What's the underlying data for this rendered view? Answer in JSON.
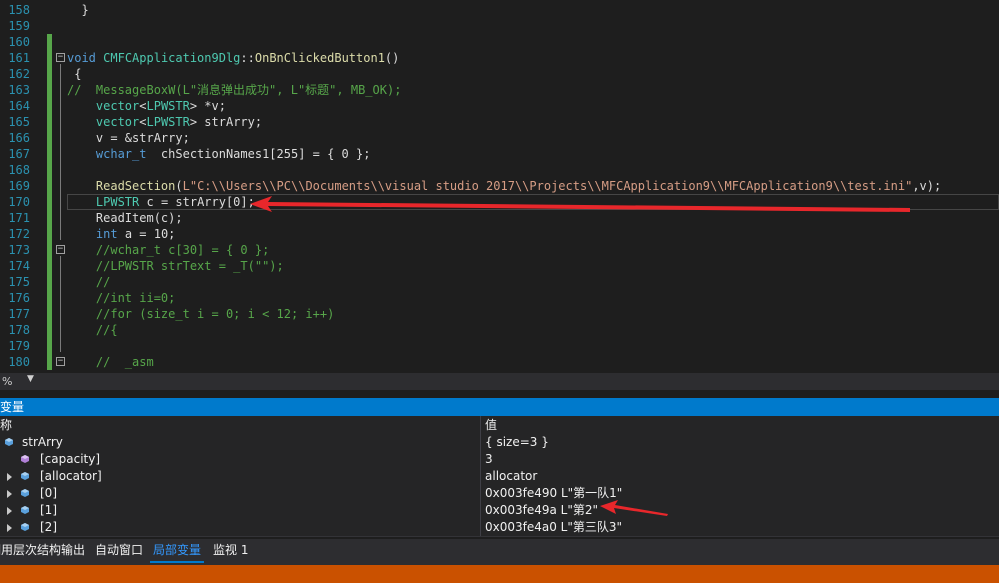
{
  "editor": {
    "lines": [
      {
        "n": "158",
        "text": "  }"
      },
      {
        "n": "159",
        "text": ""
      },
      {
        "n": "160",
        "text": ""
      },
      {
        "n": "161",
        "text": "void CMFCApplication9Dlg::OnBnClickedButton1()"
      },
      {
        "n": "162",
        "text": " {"
      },
      {
        "n": "163",
        "text": "//  MessageBoxW(L\"消息弹出成功\", L\"标题\", MB_OK);"
      },
      {
        "n": "164",
        "text": "    vector<LPWSTR> *v;"
      },
      {
        "n": "165",
        "text": "    vector<LPWSTR> strArry;"
      },
      {
        "n": "166",
        "text": "    v = &strArry;"
      },
      {
        "n": "167",
        "text": "    wchar_t  chSectionNames1[255] = { 0 };"
      },
      {
        "n": "168",
        "text": ""
      },
      {
        "n": "169",
        "text": "    ReadSection(L\"C:\\\\Users\\\\PC\\\\Documents\\\\visual studio 2017\\\\Projects\\\\MFCApplication9\\\\MFCApplication9\\\\test.ini\",v);"
      },
      {
        "n": "170",
        "text": "    LPWSTR c = strArry[0];"
      },
      {
        "n": "171",
        "text": "    ReadItem(c);"
      },
      {
        "n": "172",
        "text": "    int a = 10;"
      },
      {
        "n": "173",
        "text": "    //wchar_t c[30] = { 0 };"
      },
      {
        "n": "174",
        "text": "    //LPWSTR strText = _T(\"\");"
      },
      {
        "n": "175",
        "text": "    //"
      },
      {
        "n": "176",
        "text": "    //int ii=0;"
      },
      {
        "n": "177",
        "text": "    //for (size_t i = 0; i < 12; i++)"
      },
      {
        "n": "178",
        "text": "    //{"
      },
      {
        "n": "179",
        "text": ""
      },
      {
        "n": "180",
        "text": "    //  _asm"
      }
    ]
  },
  "zoom": {
    "value": "%"
  },
  "locals": {
    "title": "局部变量",
    "title_visible": "变量",
    "col_name": "称",
    "col_value": "值",
    "rows": [
      {
        "name": "strArry",
        "value": "{ size=3 }"
      },
      {
        "name": "[capacity]",
        "value": "3"
      },
      {
        "name": "[allocator]",
        "value": "allocator"
      },
      {
        "name": "[0]",
        "value": "0x003fe490 L\"第一队1\""
      },
      {
        "name": "[1]",
        "value": "0x003fe49a L\"第2\""
      },
      {
        "name": "[2]",
        "value": "0x003fe4a0 L\"第三队3\""
      }
    ]
  },
  "tabs": [
    {
      "label": "调用层次结构"
    },
    {
      "label": "输出"
    },
    {
      "label": "自动窗口"
    },
    {
      "label": "局部变量"
    },
    {
      "label": "监视 1"
    }
  ],
  "colors": {
    "accent": "#007acc",
    "status": "#ca5100",
    "arrow": "#e8272b"
  }
}
